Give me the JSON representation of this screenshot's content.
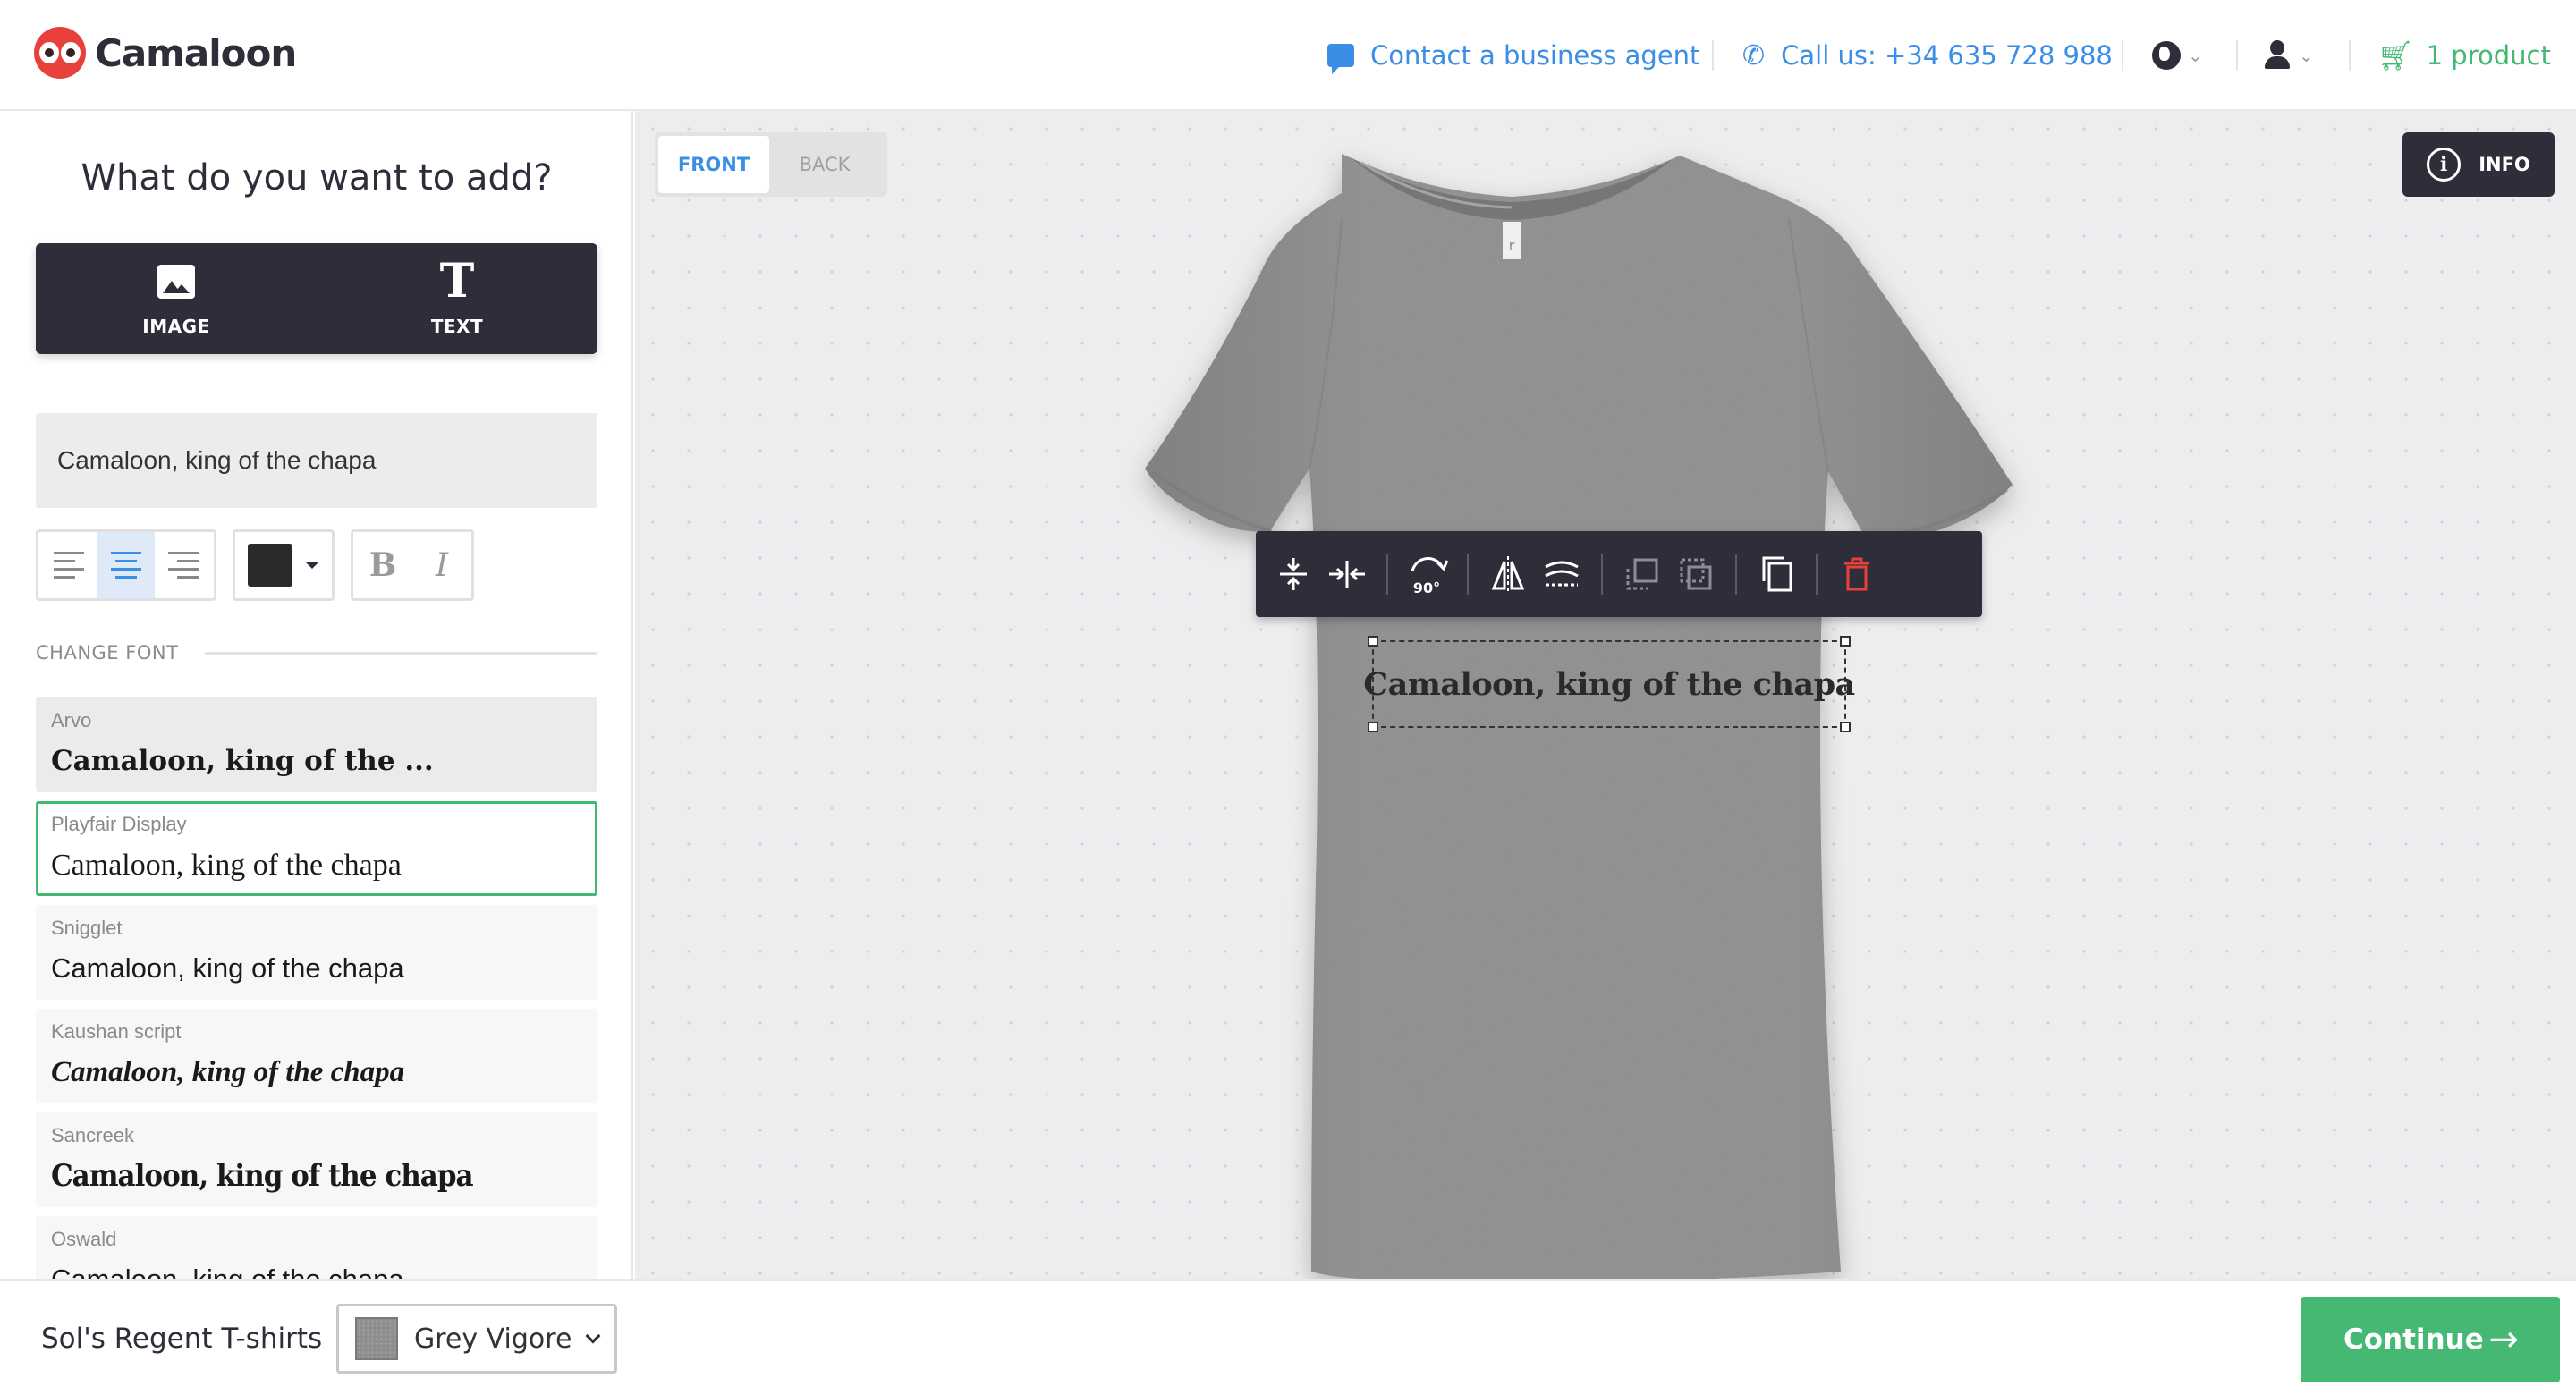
{
  "header": {
    "brand": "Camaloon",
    "contact_label": "Contact a business agent",
    "call_label": "Call us: +34 635 728 988",
    "cart_label": "1 product"
  },
  "sidebar": {
    "title": "What do you want to add?",
    "add_tabs": [
      {
        "label": "IMAGE",
        "icon": "image-icon"
      },
      {
        "label": "TEXT",
        "icon": "text-icon"
      }
    ],
    "text_input": {
      "value": "Camaloon, king of the chapa"
    },
    "alignment": {
      "selected": "center",
      "options": [
        "left",
        "center",
        "right"
      ]
    },
    "text_color": "#2a2a2a",
    "style_buttons": {
      "bold": "B",
      "italic": "I"
    },
    "font_section_label": "CHANGE FONT",
    "fonts": [
      {
        "name": "Arvo",
        "sample": "Camaloon, king of the ..."
      },
      {
        "name": "Playfair Display",
        "sample": "Camaloon, king of the chapa",
        "selected": true
      },
      {
        "name": "Snigglet",
        "sample": "Camaloon, king of the chapa"
      },
      {
        "name": "Kaushan script",
        "sample": "Camaloon, king of the chapa"
      },
      {
        "name": "Sancreek",
        "sample": "Camaloon, king of the chapa"
      },
      {
        "name": "Oswald",
        "sample": "Camaloon, king of the chapa"
      }
    ]
  },
  "canvas": {
    "side_tabs": [
      {
        "label": "FRONT",
        "active": true
      },
      {
        "label": "BACK",
        "active": false
      }
    ],
    "info_label": "INFO",
    "shirt_color": "#8f8f91",
    "design_text": "Camaloon, king of the chapa",
    "rotate_label": "90°",
    "toolbar_icons": [
      "center-vertical-icon",
      "center-horizontal-icon",
      "rotate-90-icon",
      "flip-horizontal-icon",
      "curve-text-icon",
      "bring-forward-icon",
      "send-backward-icon",
      "duplicate-icon",
      "trash-icon"
    ]
  },
  "footer": {
    "product_name": "Sol's Regent T-shirts",
    "variant": "Grey Vigore",
    "continue_label": "Continue"
  },
  "colors": {
    "accent_blue": "#3a8ee6",
    "accent_green": "#45b874",
    "dark": "#2e2e3a",
    "danger": "#e8413c"
  }
}
